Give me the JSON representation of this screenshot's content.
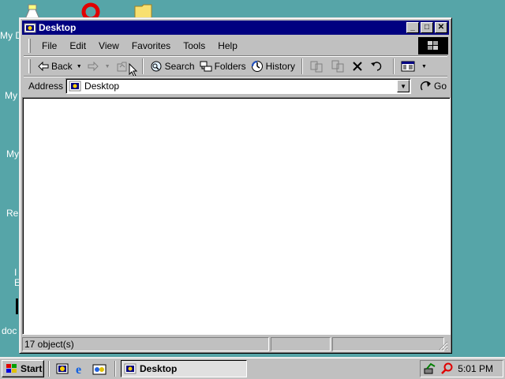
{
  "desktop": {
    "labels": [
      "My D",
      "My",
      "My",
      "Re",
      "I",
      "E",
      "doc"
    ]
  },
  "window": {
    "title": "Desktop",
    "title_buttons": {
      "minimize": "_",
      "maximize": "□",
      "close": "✕"
    },
    "menu": [
      "File",
      "Edit",
      "View",
      "Favorites",
      "Tools",
      "Help"
    ],
    "toolbar": {
      "back": "Back",
      "search": "Search",
      "folders": "Folders",
      "history": "History"
    },
    "address": {
      "label": "Address",
      "value": "Desktop",
      "go": "Go"
    },
    "status": {
      "objects": "17 object(s)"
    }
  },
  "taskbar": {
    "start": "Start",
    "task": "Desktop",
    "clock": "5:01 PM"
  },
  "colors": {
    "desktop": "#56a5a8",
    "titlebar": "#000080",
    "chrome": "#c0c0c0"
  },
  "icons": [
    "folder-icon",
    "back-arrow-icon",
    "forward-arrow-icon",
    "up-folder-icon",
    "search-icon",
    "folders-icon",
    "history-icon",
    "move-to-icon",
    "copy-to-icon",
    "delete-icon",
    "undo-icon",
    "views-icon",
    "go-icon",
    "windows-logo-icon",
    "ie-icon",
    "show-desktop-icon",
    "channels-icon",
    "network-tray-icon",
    "search-tray-icon"
  ]
}
